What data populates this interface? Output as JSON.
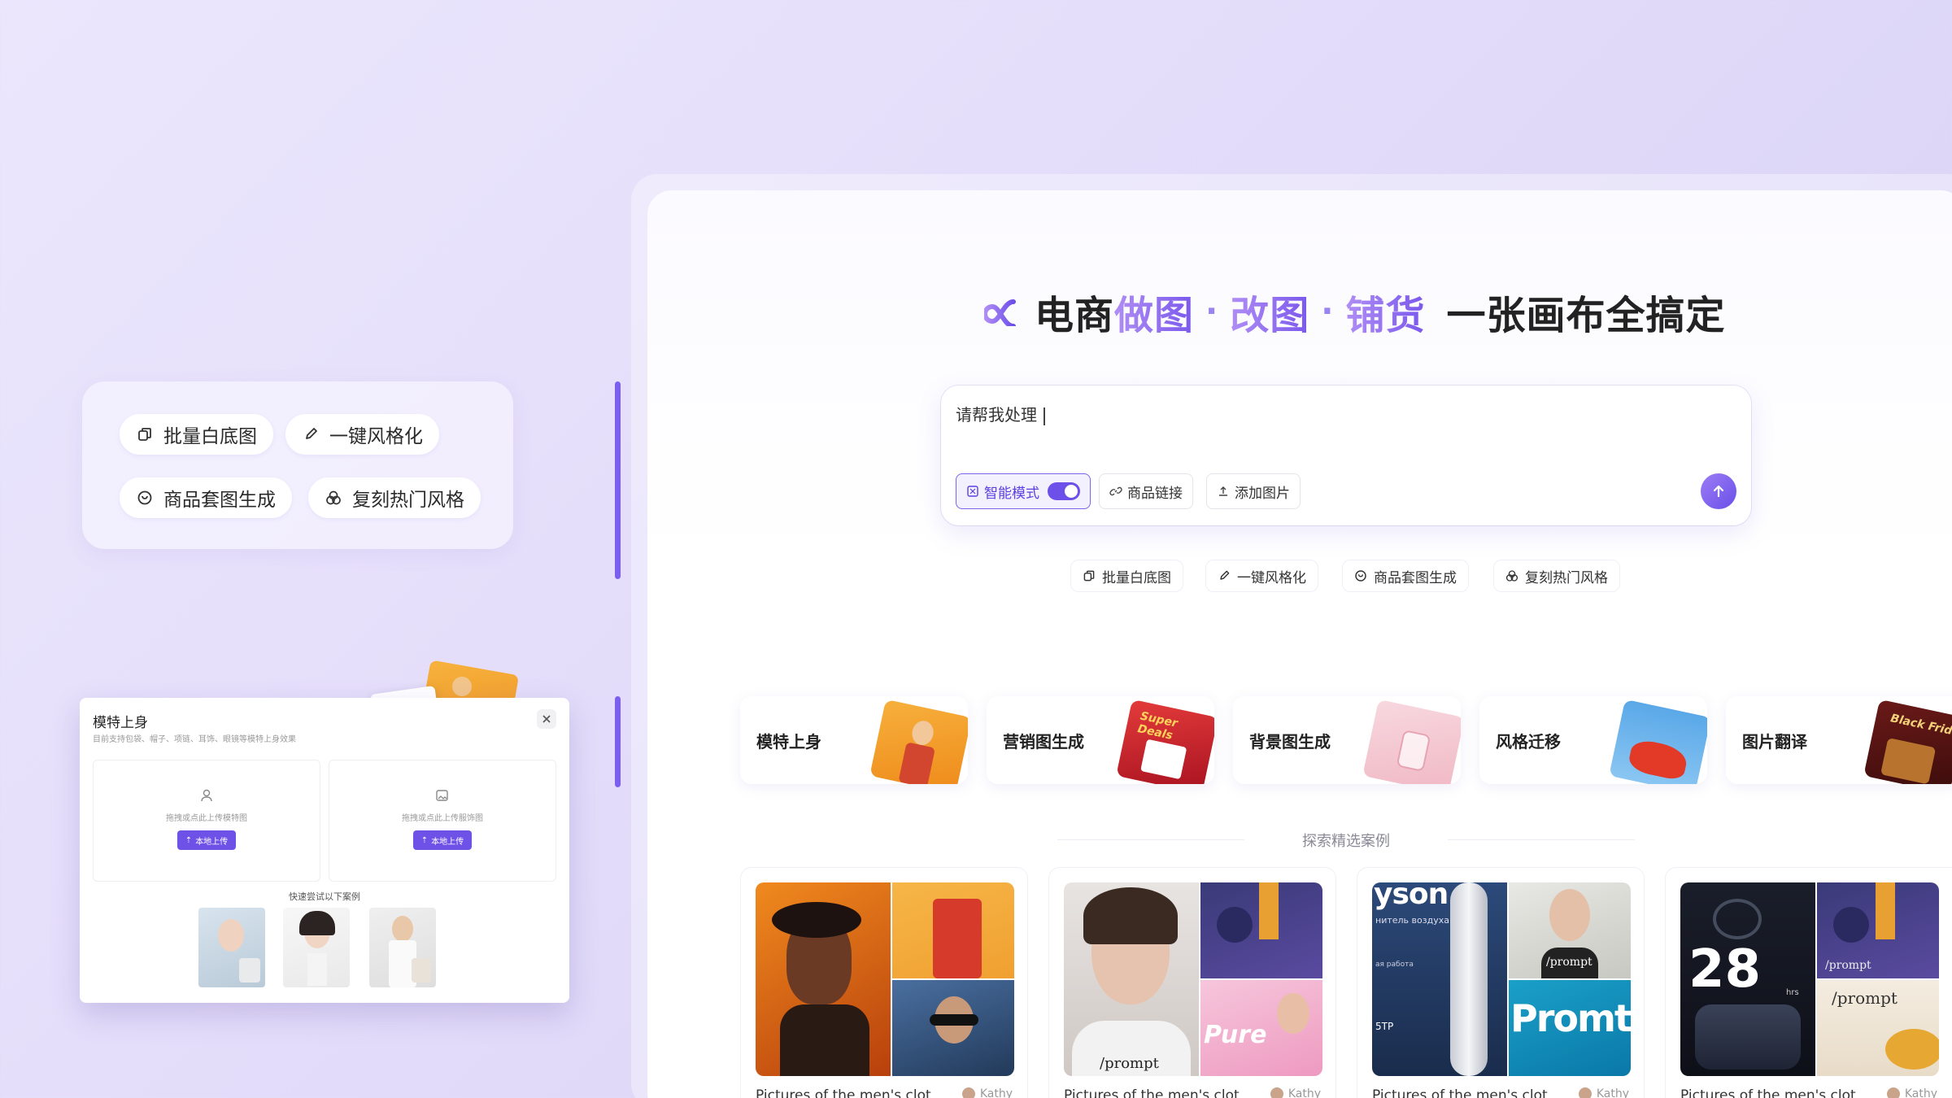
{
  "left_chips": [
    {
      "label": "批量白底图",
      "icon": "layers-icon"
    },
    {
      "label": "一键风格化",
      "icon": "brush-icon"
    },
    {
      "label": "商品套图生成",
      "icon": "bag-icon"
    },
    {
      "label": "复刻热门风格",
      "icon": "sparkle-icon"
    }
  ],
  "dialog": {
    "title": "模特上身",
    "subtitle": "目前支持包袋、帽子、项链、耳饰、眼镜等模特上身效果",
    "upload_model_hint": "拖拽或点此上传模特图",
    "upload_product_hint": "拖拽或点此上传服饰图",
    "upload_button": "本地上传",
    "try_label": "快速尝试以下案例"
  },
  "headline": {
    "part1": "电商",
    "part2": "做图",
    "part3": "改图",
    "part4": "铺货",
    "part5": "一张画布全搞定",
    "separator": "·"
  },
  "prompt": {
    "value": "请帮我处理",
    "smart_mode_label": "智能模式",
    "smart_mode_on": true,
    "product_link_label": "商品链接",
    "add_image_label": "添加图片"
  },
  "quick_chips": [
    {
      "label": "批量白底图"
    },
    {
      "label": "一键风格化"
    },
    {
      "label": "商品套图生成"
    },
    {
      "label": "复刻热门风格"
    }
  ],
  "features": [
    {
      "label": "模特上身"
    },
    {
      "label": "营销图生成"
    },
    {
      "label": "背景图生成"
    },
    {
      "label": "风格迁移"
    },
    {
      "label": "图片翻译"
    }
  ],
  "feature_art_text": {
    "marketing": "Super Deals",
    "translate": "Black Friday"
  },
  "cases_title": "探索精选案例",
  "cases": [
    {
      "caption": "Pictures of the men's clot",
      "author": "Kathy",
      "overlay": ""
    },
    {
      "caption": "Pictures of the men's clot",
      "author": "Kathy",
      "overlay": "/prompt"
    },
    {
      "caption": "Pictures of the men's clot",
      "author": "Kathy",
      "overlay": "Promt"
    },
    {
      "caption": "Pictures of the men's clot",
      "author": "Kathy",
      "overlay": "/prompt"
    }
  ],
  "case_texts": {
    "dyson": "yson",
    "russian": "нитель воздуха",
    "small_ru": "ая работа",
    "num": "28",
    "hrs": "hrs",
    "pure": "Pure",
    "stp": "5TP"
  },
  "colors": {
    "accent": "#7a5ff0",
    "brand_purple": "#6e52e8"
  }
}
